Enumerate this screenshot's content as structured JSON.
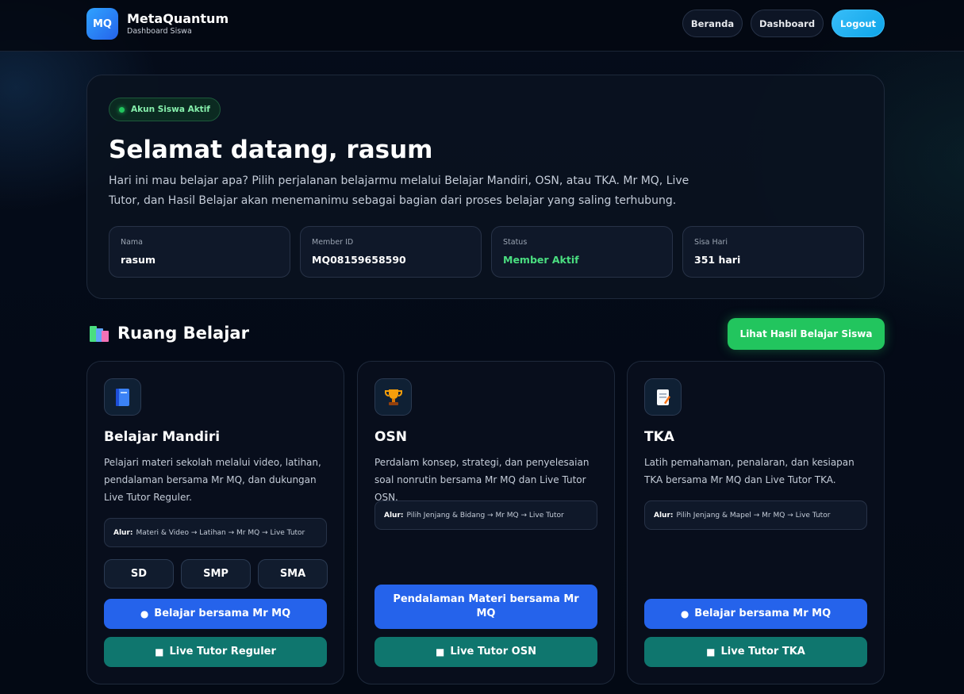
{
  "brand": {
    "logo_text": "MQ",
    "name": "MetaQuantum",
    "subtitle": "Dashboard Siswa"
  },
  "nav": {
    "home": "Beranda",
    "dashboard": "Dashboard",
    "logout": "Logout"
  },
  "welcome": {
    "badge": "Akun Siswa Aktif",
    "title": "Selamat datang, rasum",
    "description": "Hari ini mau belajar apa? Pilih perjalanan belajarmu melalui Belajar Mandiri, OSN, atau TKA. Mr MQ, Live Tutor, dan Hasil Belajar akan menemanimu sebagai bagian dari proses belajar yang saling terhubung.",
    "stats": [
      {
        "label": "Nama",
        "value": "rasum"
      },
      {
        "label": "Member ID",
        "value": "MQ08159658590"
      },
      {
        "label": "Status",
        "value": "Member Aktif"
      },
      {
        "label": "Sisa Hari",
        "value": "351 hari"
      }
    ]
  },
  "section": {
    "icon": "books-icon",
    "title": "Ruang Belajar",
    "results_button": "Lihat Hasil Belajar Siswa"
  },
  "cards": [
    {
      "icon": "book-icon",
      "title": "Belajar Mandiri",
      "description": "Pelajari materi sekolah melalui video, latihan, pendalaman bersama Mr MQ, dan dukungan Live Tutor Reguler.",
      "flow_label": "Alur:",
      "flow": "Materi & Video → Latihan → Mr MQ → Live Tutor",
      "levels": [
        "SD",
        "SMP",
        "SMA"
      ],
      "primary_button": "Belajar bersama Mr MQ",
      "secondary_button": "Live Tutor Reguler"
    },
    {
      "icon": "trophy-icon",
      "title": "OSN",
      "description": "Perdalam konsep, strategi, dan penyelesaian soal nonrutin bersama Mr MQ dan Live Tutor OSN.",
      "flow_label": "Alur:",
      "flow": "Pilih Jenjang & Bidang → Mr MQ → Live Tutor",
      "primary_button": "Pendalaman Materi bersama Mr MQ",
      "secondary_button": "Live Tutor OSN"
    },
    {
      "icon": "memo-icon",
      "title": "TKA",
      "description": "Latih pemahaman, penalaran, dan kesiapan TKA bersama Mr MQ dan Live Tutor TKA.",
      "flow_label": "Alur:",
      "flow": "Pilih Jenjang & Mapel → Mr MQ → Live Tutor",
      "primary_button": "Belajar bersama Mr MQ",
      "secondary_button": "Live Tutor TKA"
    }
  ]
}
